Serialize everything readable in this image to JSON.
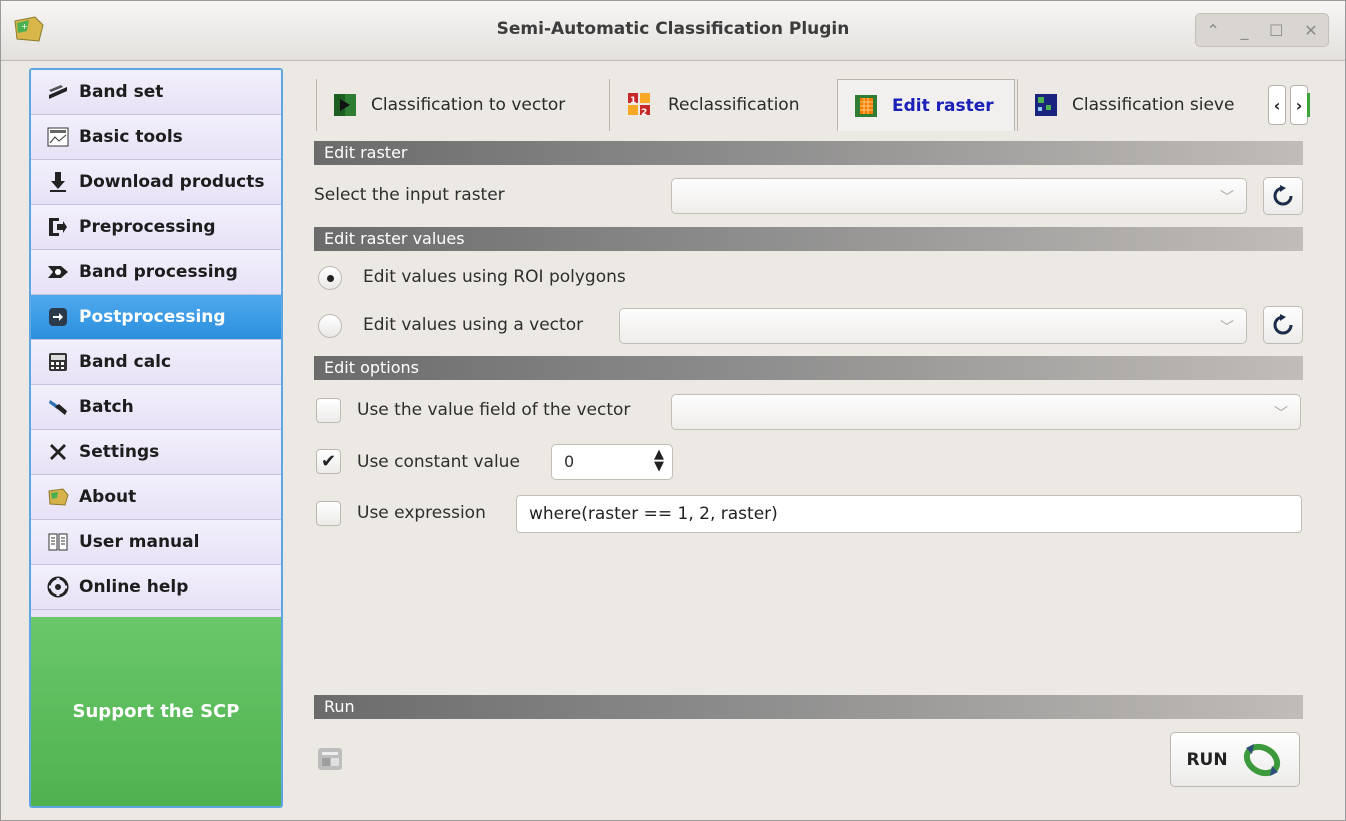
{
  "window": {
    "title": "Semi-Automatic Classification Plugin",
    "controls": [
      "⌃",
      "_",
      "☐",
      "✕"
    ]
  },
  "sidebar": {
    "items": [
      {
        "label": "Band set",
        "icon": "band-set-icon"
      },
      {
        "label": "Basic tools",
        "icon": "basic-tools-icon"
      },
      {
        "label": "Download products",
        "icon": "download-icon"
      },
      {
        "label": "Preprocessing",
        "icon": "preprocessing-icon"
      },
      {
        "label": "Band processing",
        "icon": "band-processing-icon"
      },
      {
        "label": "Postprocessing",
        "icon": "postprocessing-icon",
        "active": true
      },
      {
        "label": "Band calc",
        "icon": "calculator-icon"
      },
      {
        "label": "Batch",
        "icon": "batch-icon"
      },
      {
        "label": "Settings",
        "icon": "settings-icon"
      },
      {
        "label": "About",
        "icon": "about-icon"
      },
      {
        "label": "User manual",
        "icon": "manual-icon"
      },
      {
        "label": "Online help",
        "icon": "help-icon"
      }
    ],
    "support_label": "Support the SCP"
  },
  "tabs": [
    {
      "label": "Classification to vector",
      "icon": "classification-to-vector-icon"
    },
    {
      "label": "Reclassification",
      "icon": "reclassification-icon"
    },
    {
      "label": "Edit raster",
      "icon": "edit-raster-icon",
      "active": true
    },
    {
      "label": "Classification sieve",
      "icon": "classification-sieve-icon"
    }
  ],
  "sections": {
    "edit_raster": "Edit raster",
    "edit_raster_values": "Edit raster values",
    "edit_options": "Edit options",
    "run": "Run"
  },
  "input_raster": {
    "label": "Select the input raster",
    "value": ""
  },
  "edit_values": {
    "roi_label": "Edit values using ROI polygons",
    "roi_selected": true,
    "vector_label": "Edit values using a vector",
    "vector_value": ""
  },
  "options": {
    "value_field_label": "Use the value field of the vector",
    "value_field_checked": false,
    "value_field_value": "",
    "constant_label": "Use constant value",
    "constant_checked": true,
    "constant_value": "0",
    "expression_label": "Use expression",
    "expression_checked": false,
    "expression_value": "where(raster == 1, 2, raster)"
  },
  "run": {
    "button_label": "RUN"
  },
  "colors": {
    "active_sidebar": "#2b8fdd",
    "support_green": "#56b856",
    "active_tab_text": "#1a20b8"
  }
}
